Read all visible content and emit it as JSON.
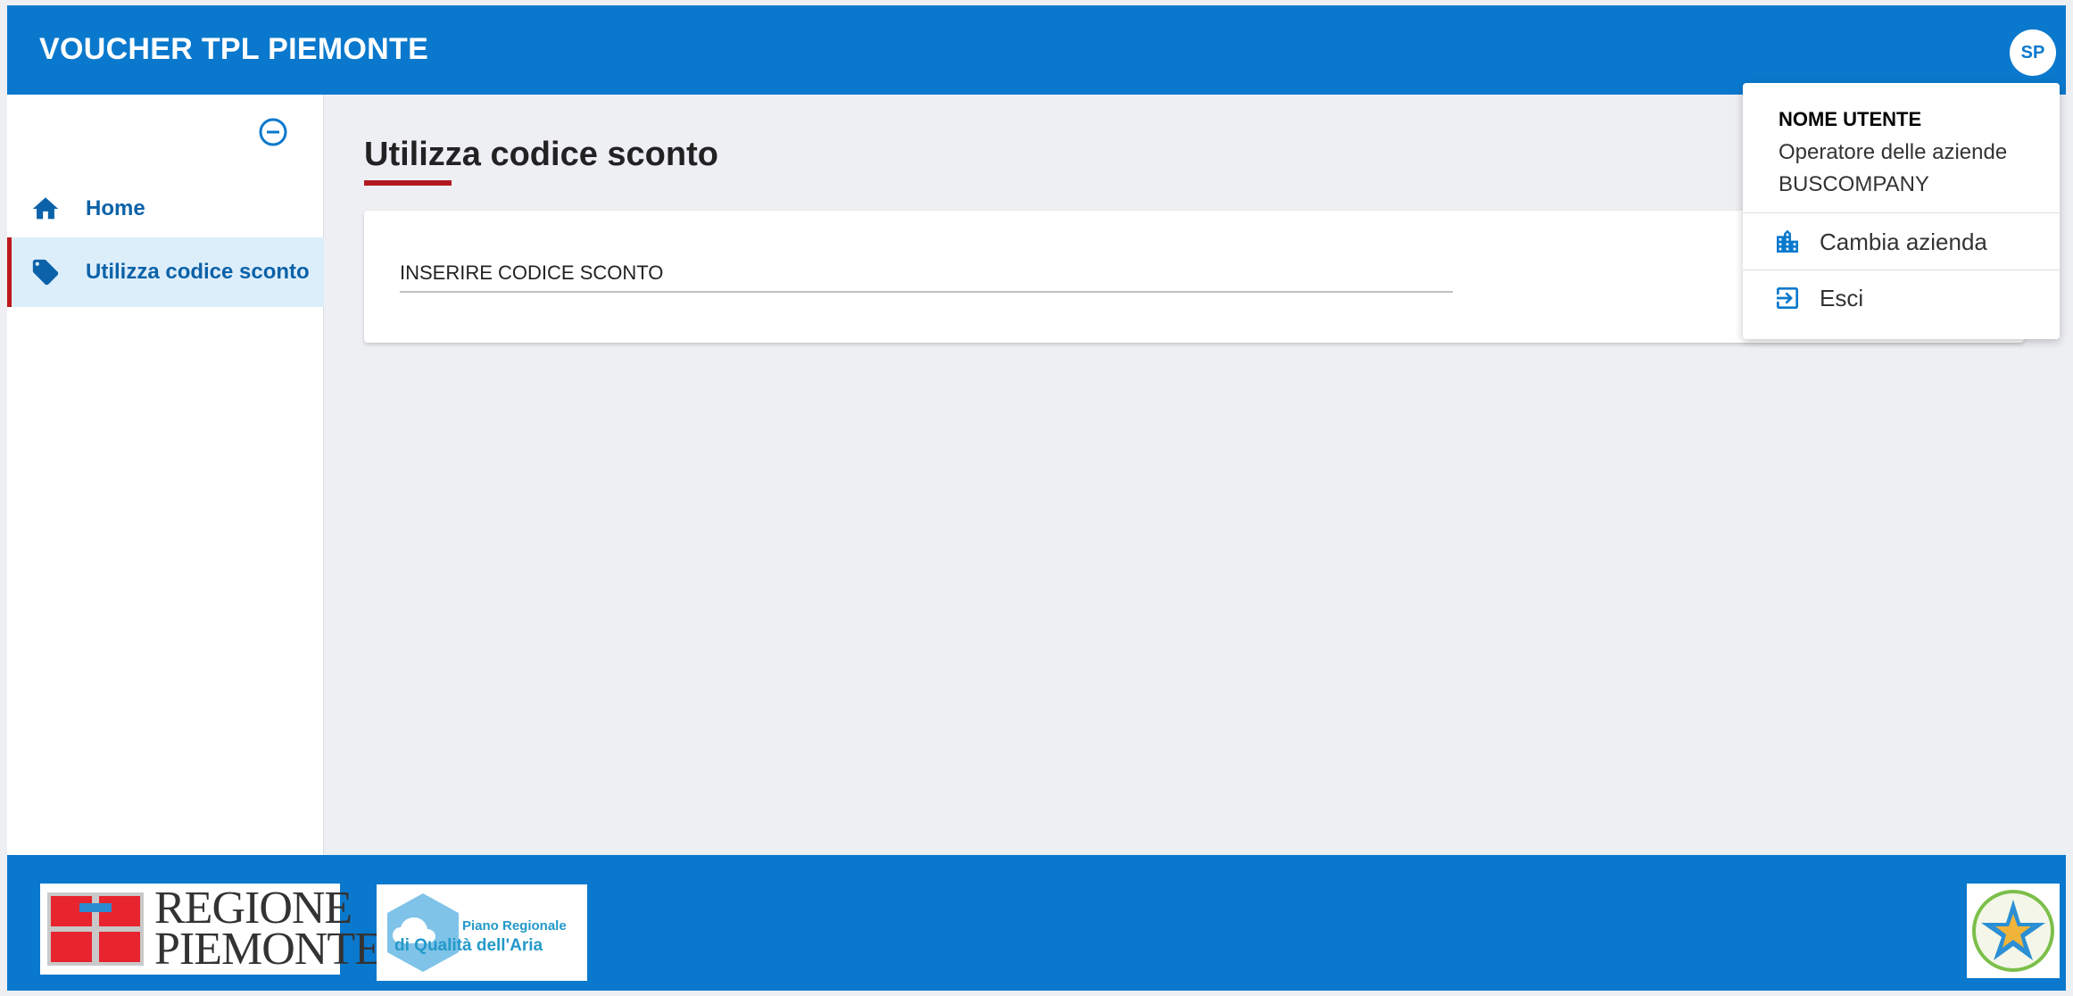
{
  "header": {
    "app_title": "VOUCHER TPL PIEMONTE",
    "avatar_initials": "SP"
  },
  "sidebar": {
    "items": [
      {
        "label": "Home",
        "icon": "home-icon",
        "active": false
      },
      {
        "label": "Utilizza codice sconto",
        "icon": "tag-icon",
        "active": true
      }
    ]
  },
  "main": {
    "page_title": "Utilizza codice sconto",
    "discount_field": {
      "label": "INSERIRE CODICE SCONTO",
      "value": ""
    }
  },
  "user_menu": {
    "name": "NOME UTENTE",
    "role": "Operatore delle aziende",
    "company": "BUSCOMPANY",
    "items": [
      {
        "label": "Cambia azienda",
        "icon": "building-icon"
      },
      {
        "label": "Esci",
        "icon": "logout-icon"
      }
    ]
  },
  "footer": {
    "logo_regione_line1": "REGIONE",
    "logo_regione_line2": "PIEMONTE",
    "logo_aria_line1": "Piano Regionale",
    "logo_aria_line2": "di Qualità dell'Aria"
  },
  "colors": {
    "primary": "#0a79cd",
    "accent_red": "#b2191f",
    "active_bg": "#ddeefb",
    "page_bg": "#eeeff3"
  }
}
